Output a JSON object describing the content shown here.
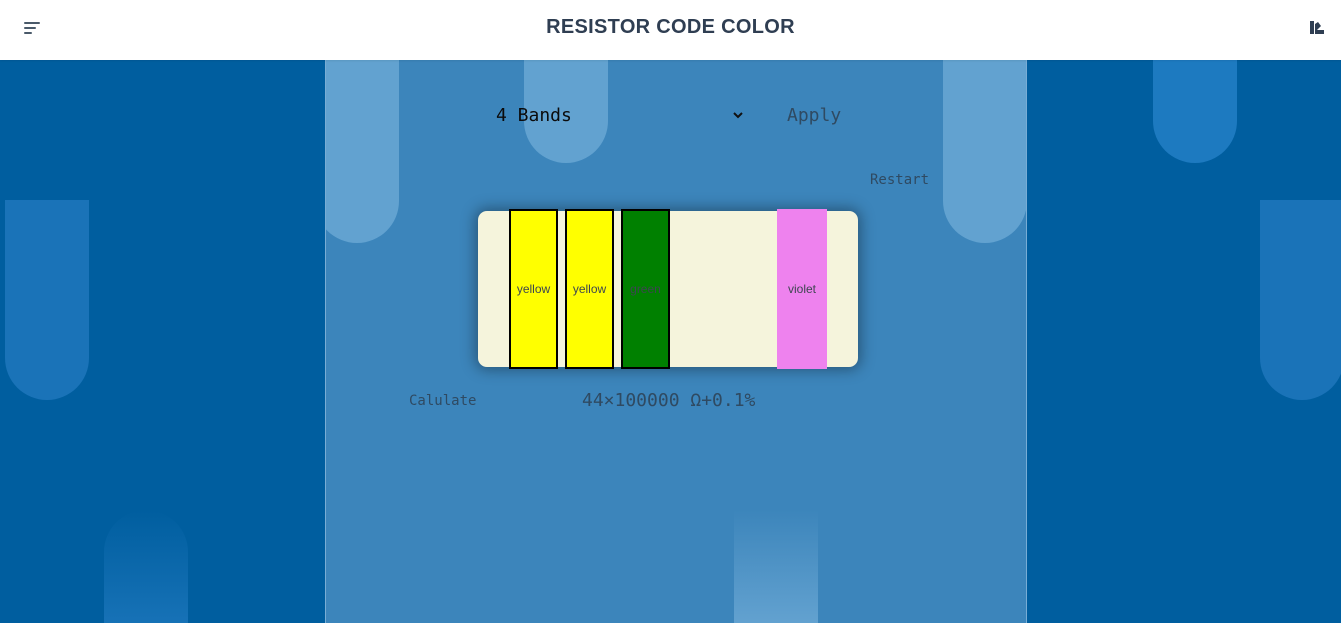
{
  "header": {
    "title": "RESISTOR CODE COLOR",
    "menu_icon": "hamburger-menu-icon",
    "palette_icon": "color-palette-icon"
  },
  "controls": {
    "band_select": {
      "selected": "4 Bands"
    },
    "apply_label": "Apply",
    "restart_label": "Restart",
    "calculate_label": "Calulate"
  },
  "resistor": {
    "bands": [
      {
        "label": "yellow",
        "color": "#ffff00"
      },
      {
        "label": "yellow",
        "color": "#ffff00"
      },
      {
        "label": "green",
        "color": "#008000"
      },
      {
        "label": "violet",
        "color": "#ee82ee"
      }
    ],
    "body_color": "#f5f4dc"
  },
  "result": {
    "text": "44×100000 Ω+0.1%"
  },
  "colors": {
    "background": "#005e9f",
    "panel": "#4e8fbe",
    "text": "#2f4a62"
  }
}
